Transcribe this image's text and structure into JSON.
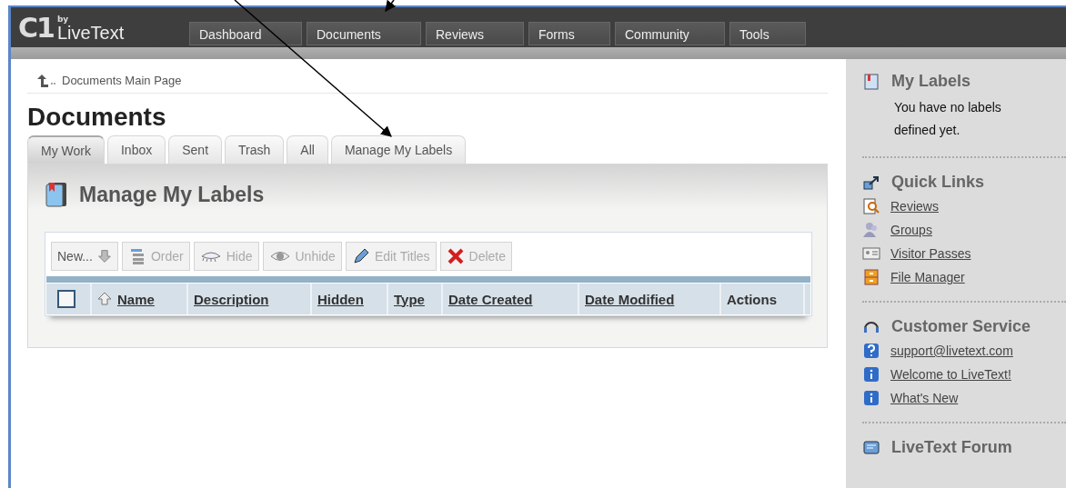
{
  "header": {
    "logo_mark": "C1",
    "logo_by": "by",
    "logo_name": "LiveText",
    "nav": [
      {
        "label": "Dashboard"
      },
      {
        "label": "Documents"
      },
      {
        "label": "Reviews"
      },
      {
        "label": "Forms"
      },
      {
        "label": "Community"
      },
      {
        "label": "Tools"
      }
    ]
  },
  "breadcrumb": "Documents Main Page",
  "title": "Documents",
  "tabs": [
    {
      "label": "My Work",
      "selected": true
    },
    {
      "label": "Inbox",
      "selected": false
    },
    {
      "label": "Sent",
      "selected": false
    },
    {
      "label": "Trash",
      "selected": false
    },
    {
      "label": "All",
      "selected": false
    },
    {
      "label": "Manage My Labels",
      "selected": false
    }
  ],
  "panel": {
    "title": "Manage My Labels",
    "toolbar": [
      {
        "label": "New...",
        "kind": "down",
        "disabled": false
      },
      {
        "label": "Order",
        "kind": "order",
        "disabled": true
      },
      {
        "label": "Hide",
        "kind": "hide",
        "disabled": true
      },
      {
        "label": "Unhide",
        "kind": "eye",
        "disabled": true
      },
      {
        "label": "Edit Titles",
        "kind": "pencil",
        "disabled": true
      },
      {
        "label": "Delete",
        "kind": "x",
        "disabled": true
      }
    ],
    "select_all_checked": false,
    "columns": [
      {
        "label": "Name",
        "sortable": true,
        "sorted": true
      },
      {
        "label": "Description",
        "sortable": true,
        "sorted": false
      },
      {
        "label": "Hidden",
        "sortable": true,
        "sorted": false
      },
      {
        "label": "Type",
        "sortable": true,
        "sorted": false
      },
      {
        "label": "Date Created",
        "sortable": true,
        "sorted": false
      },
      {
        "label": "Date Modified",
        "sortable": true,
        "sorted": false
      },
      {
        "label": "Actions",
        "sortable": false,
        "sorted": false
      }
    ]
  },
  "sidebar": [
    {
      "title": "My Labels",
      "kind": "labels",
      "text": "You have no labels defined yet."
    },
    {
      "title": "Quick Links",
      "kind": "link",
      "links": [
        {
          "label": "Reviews",
          "kind": "review"
        },
        {
          "label": "Groups",
          "kind": "group"
        },
        {
          "label": "Visitor Passes",
          "kind": "pass"
        },
        {
          "label": "File Manager",
          "kind": "cabinet"
        }
      ]
    },
    {
      "title": "Customer Service",
      "kind": "headset",
      "links": [
        {
          "label": "support@livetext.com",
          "kind": "question"
        },
        {
          "label": "Welcome to LiveText!",
          "kind": "info"
        },
        {
          "label": "What's New",
          "kind": "info"
        }
      ]
    },
    {
      "title": "LiveText Forum",
      "kind": "forum"
    }
  ]
}
